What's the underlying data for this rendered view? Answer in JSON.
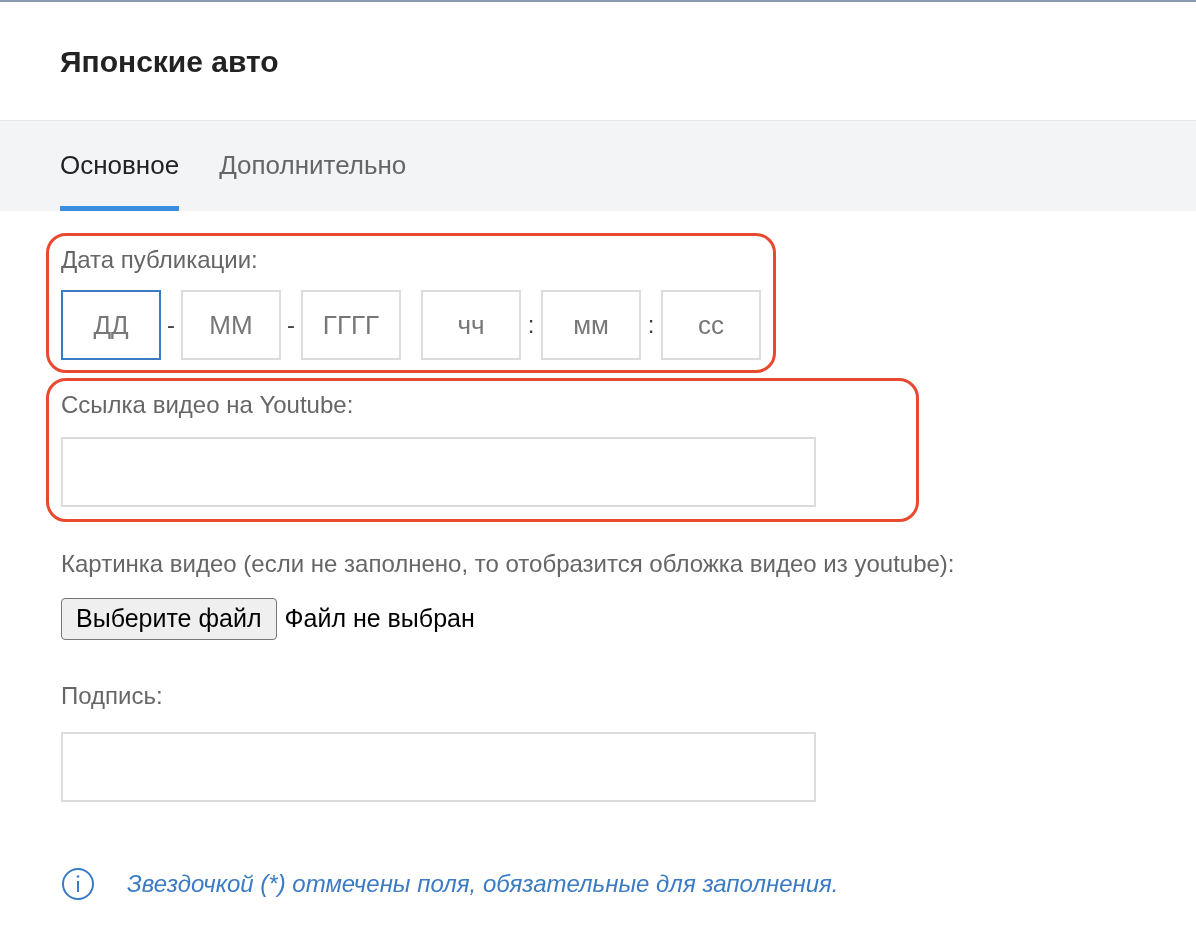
{
  "title": "Японские авто",
  "tabs": [
    {
      "label": "Основное",
      "selected": true
    },
    {
      "label": "Дополнительно",
      "selected": false
    }
  ],
  "publish_date": {
    "label": "Дата публикации:",
    "highlighted": true,
    "fields": [
      {
        "placeholder": "ДД",
        "focused": true,
        "separator": "-"
      },
      {
        "placeholder": "ММ",
        "focused": false,
        "separator": "-"
      },
      {
        "placeholder": "ГГГГ",
        "focused": false
      },
      {
        "placeholder": "чч",
        "focused": false,
        "separator": ":"
      },
      {
        "placeholder": "мм",
        "focused": false,
        "separator": ":"
      },
      {
        "placeholder": "сс",
        "focused": false
      }
    ]
  },
  "youtube": {
    "label": "Ссылка видео на Youtube:",
    "highlighted": true
  },
  "thumbnail": {
    "label": "Картинка видео (если не заполнено, то отобразится обложка видео из youtube):",
    "button": "Выберите файл",
    "status": "Файл не выбран"
  },
  "caption": {
    "label": "Подпись:"
  },
  "note": "Звездочкой (*) отмечены поля, обязательные для заполнения."
}
